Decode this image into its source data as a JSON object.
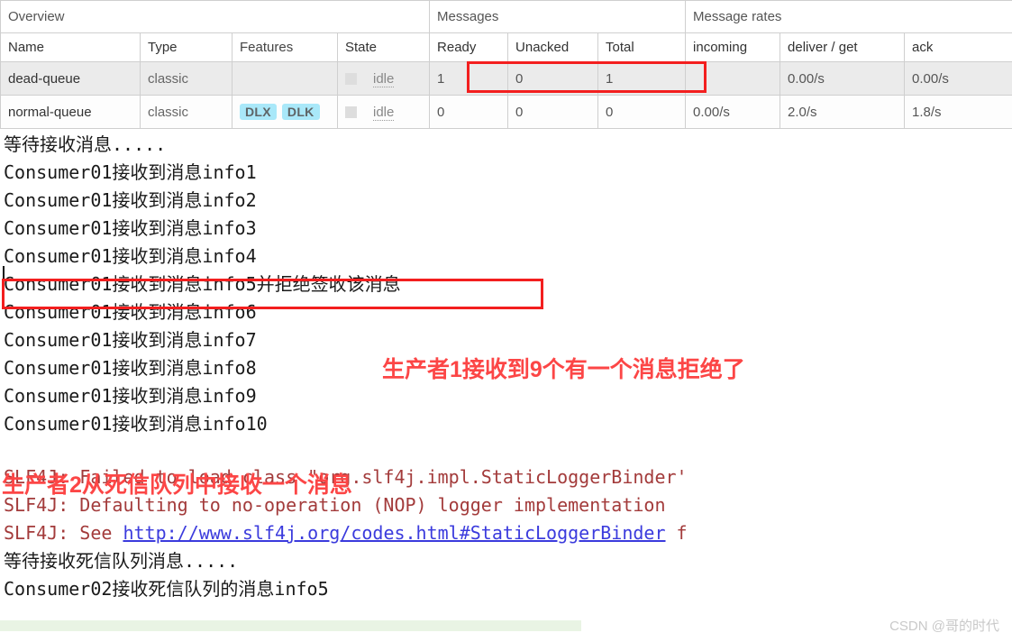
{
  "table": {
    "group_headers": [
      {
        "label": "Overview",
        "span": 4
      },
      {
        "label": "Messages",
        "span": 3
      },
      {
        "label": "Message rates",
        "span": 3
      }
    ],
    "columns": [
      {
        "key": "name",
        "label": "Name",
        "bold": true
      },
      {
        "key": "type",
        "label": "Type",
        "bold": true
      },
      {
        "key": "features",
        "label": "Features",
        "bold": false
      },
      {
        "key": "state",
        "label": "State",
        "bold": true
      },
      {
        "key": "ready",
        "label": "Ready",
        "bold": true
      },
      {
        "key": "unacked",
        "label": "Unacked",
        "bold": true
      },
      {
        "key": "total",
        "label": "Total",
        "bold": true
      },
      {
        "key": "incoming",
        "label": "incoming",
        "bold": true
      },
      {
        "key": "deliver",
        "label": "deliver / get",
        "bold": true
      },
      {
        "key": "ack",
        "label": "ack",
        "bold": true
      }
    ],
    "rows": [
      {
        "name": "dead-queue",
        "type": "classic",
        "features": [],
        "state": "idle",
        "ready": "1",
        "unacked": "0",
        "total": "1",
        "incoming": "",
        "deliver": "0.00/s",
        "ack": "0.00/s"
      },
      {
        "name": "normal-queue",
        "type": "classic",
        "features": [
          "DLX",
          "DLK"
        ],
        "state": "idle",
        "ready": "0",
        "unacked": "0",
        "total": "0",
        "incoming": "0.00/s",
        "deliver": "2.0/s",
        "ack": "1.8/s"
      }
    ]
  },
  "console": {
    "lines": [
      {
        "text": "等待接收消息....."
      },
      {
        "text": "Consumer01接收到消息info1"
      },
      {
        "text": "Consumer01接收到消息info2"
      },
      {
        "text": "Consumer01接收到消息info3"
      },
      {
        "text": "Consumer01接收到消息info4"
      },
      {
        "text": "Consumer01接收到消息info5并拒绝签收该消息"
      },
      {
        "text": "Consumer01接收到消息info6"
      },
      {
        "text": "Consumer01接收到消息info7"
      },
      {
        "text": "Consumer01接收到消息info8"
      },
      {
        "text": "Consumer01接收到消息info9"
      },
      {
        "text": "Consumer01接收到消息info10"
      }
    ],
    "slf4j": {
      "line1": "SLF4J: Failed to load class \"org.slf4j.impl.StaticLoggerBinder'",
      "line2": "SLF4J: Defaulting to no-operation (NOP) logger implementation",
      "line3_prefix": "SLF4J: See ",
      "line3_link": "http://www.slf4j.org/codes.html#StaticLoggerBinder",
      "line3_suffix": " f"
    },
    "tail_lines": [
      {
        "text": "等待接收死信队列消息....."
      },
      {
        "text": "Consumer02接收死信队列的消息info5"
      }
    ]
  },
  "annotations": {
    "producer1": "生产者1接收到9个有一个消息拒绝了",
    "producer2": "生产者2从死信队列中接收一个消息",
    "color": "#fc4646"
  },
  "watermark": {
    "text": "CSDN @哥的时代"
  }
}
